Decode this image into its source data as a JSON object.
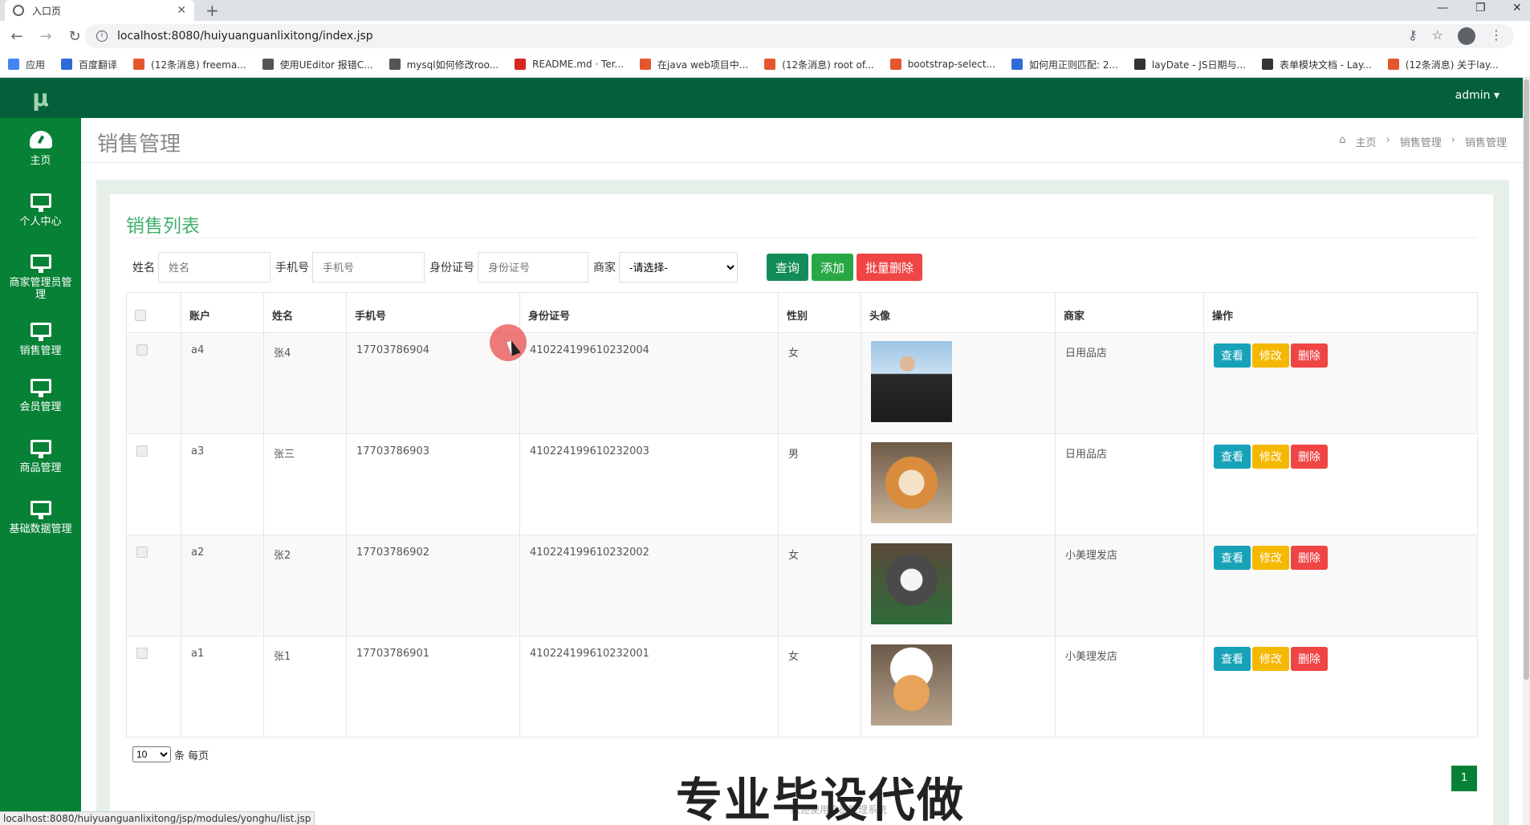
{
  "browser": {
    "tab_title": "入口页",
    "url": "localhost:8080/huiyuanguanlixitong/index.jsp",
    "status_url": "localhost:8080/huiyuanguanlixitong/jsp/modules/yonghu/list.jsp",
    "bookmarks": [
      {
        "label": "应用",
        "color": "#4285f4"
      },
      {
        "label": "百度翻译",
        "color": "#2f6bd8"
      },
      {
        "label": "(12条消息) freema...",
        "color": "#e4572e"
      },
      {
        "label": "使用UEditor 报错C...",
        "color": "#555555"
      },
      {
        "label": "mysql如何修改roo...",
        "color": "#555555"
      },
      {
        "label": "README.md · Ter...",
        "color": "#d7261e"
      },
      {
        "label": "在java web项目中...",
        "color": "#e4572e"
      },
      {
        "label": "(12条消息) root of...",
        "color": "#e4572e"
      },
      {
        "label": "bootstrap-select...",
        "color": "#e4572e"
      },
      {
        "label": "如何用正则匹配: 2...",
        "color": "#2f6bd8"
      },
      {
        "label": "layDate - JS日期与...",
        "color": "#333333"
      },
      {
        "label": "表单模块文档 - Lay...",
        "color": "#333333"
      },
      {
        "label": "(12条消息) 关于lay...",
        "color": "#e4572e"
      }
    ]
  },
  "app": {
    "logo": "μ",
    "user": "admin",
    "sidebar": [
      {
        "label": "主页",
        "icon": "dashboard-icon"
      },
      {
        "label": "个人中心",
        "icon": "monitor-icon"
      },
      {
        "label": "商家管理员管理",
        "icon": "monitor-icon"
      },
      {
        "label": "销售管理",
        "icon": "monitor-icon"
      },
      {
        "label": "会员管理",
        "icon": "monitor-icon"
      },
      {
        "label": "商品管理",
        "icon": "monitor-icon"
      },
      {
        "label": "基础数据管理",
        "icon": "monitor-icon"
      }
    ],
    "page_title": "销售管理",
    "breadcrumb": [
      "主页",
      "销售管理",
      "销售管理"
    ],
    "panel_title": "销售列表",
    "filters": {
      "name_label": "姓名",
      "name_placeholder": "姓名",
      "phone_label": "手机号",
      "phone_placeholder": "手机号",
      "id_label": "身份证号",
      "id_placeholder": "身份证号",
      "merchant_label": "商家",
      "merchant_selected": "-请选择-",
      "search_btn": "查询",
      "add_btn": "添加",
      "batch_delete_btn": "批量删除"
    },
    "table": {
      "columns": [
        "账户",
        "姓名",
        "手机号",
        "身份证号",
        "性别",
        "头像",
        "商家",
        "操作"
      ],
      "rows": [
        {
          "account": "a4",
          "name": "张4",
          "phone": "17703786904",
          "id": "410224199610232004",
          "gender": "女",
          "merchant": "日用品店",
          "avatar": "person-photo"
        },
        {
          "account": "a3",
          "name": "张三",
          "phone": "17703786903",
          "id": "410224199610232003",
          "gender": "男",
          "merchant": "日用品店",
          "avatar": "dog-photo"
        },
        {
          "account": "a2",
          "name": "张2",
          "phone": "17703786902",
          "id": "410224199610232002",
          "gender": "女",
          "merchant": "小美理发店",
          "avatar": "cat-photo"
        },
        {
          "account": "a1",
          "name": "张1",
          "phone": "17703786901",
          "id": "410224199610232001",
          "gender": "女",
          "merchant": "小美理发店",
          "avatar": "cat-hat-photo"
        }
      ],
      "actions": {
        "view": "查看",
        "edit": "修改",
        "delete": "删除"
      }
    },
    "pager": {
      "page_size": "10",
      "page_size_suffix": "条 每页",
      "current_page": "1"
    },
    "watermark": "专业毕设代做",
    "footer_note": "欢迎使用会员管理系统"
  },
  "colors": {
    "sidebar": "#078135",
    "topbar": "#04603a",
    "accent": "#41b06d"
  }
}
